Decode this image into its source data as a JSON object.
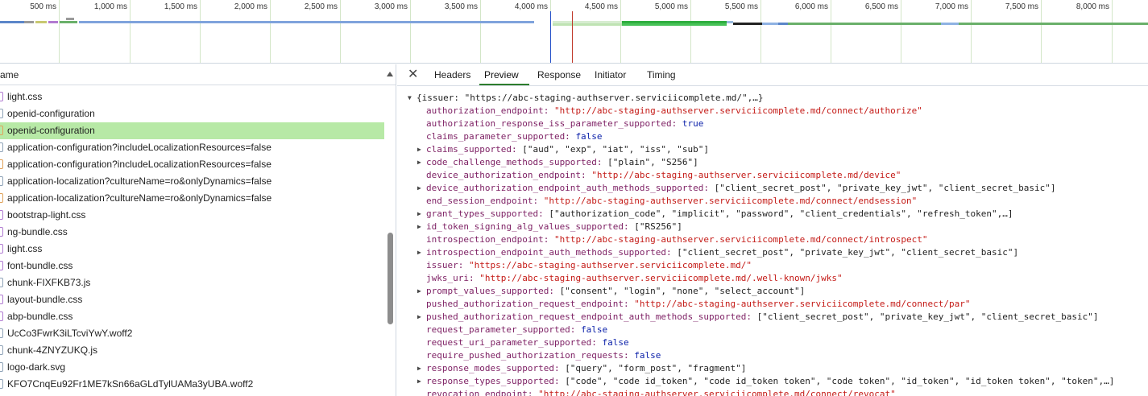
{
  "timeline": {
    "ticks": [
      "500 ms",
      "1,000 ms",
      "1,500 ms",
      "2,000 ms",
      "2,500 ms",
      "3,000 ms",
      "3,500 ms",
      "4,000 ms",
      "4,500 ms",
      "5,000 ms",
      "5,500 ms",
      "6,000 ms",
      "6,500 ms",
      "7,000 ms",
      "7,500 ms",
      "8,000 ms"
    ]
  },
  "name_list": {
    "header": "ame",
    "rows": [
      {
        "label": "light.css",
        "type": "css",
        "selected": false
      },
      {
        "label": "openid-configuration",
        "type": "doc",
        "selected": false
      },
      {
        "label": "openid-configuration",
        "type": "xhr",
        "selected": true
      },
      {
        "label": "application-configuration?includeLocalizationResources=false",
        "type": "doc",
        "selected": false
      },
      {
        "label": "application-configuration?includeLocalizationResources=false",
        "type": "xhr",
        "selected": false
      },
      {
        "label": "application-localization?cultureName=ro&onlyDynamics=false",
        "type": "doc",
        "selected": false
      },
      {
        "label": "application-localization?cultureName=ro&onlyDynamics=false",
        "type": "xhr",
        "selected": false
      },
      {
        "label": "bootstrap-light.css",
        "type": "css",
        "selected": false
      },
      {
        "label": "ng-bundle.css",
        "type": "css",
        "selected": false
      },
      {
        "label": "light.css",
        "type": "css",
        "selected": false
      },
      {
        "label": "font-bundle.css",
        "type": "css",
        "selected": false
      },
      {
        "label": "chunk-FIXFKB73.js",
        "type": "doc",
        "selected": false
      },
      {
        "label": "layout-bundle.css",
        "type": "css",
        "selected": false
      },
      {
        "label": "abp-bundle.css",
        "type": "css",
        "selected": false
      },
      {
        "label": "UcCo3FwrK3iLTcviYwY.woff2",
        "type": "doc",
        "selected": false
      },
      {
        "label": "chunk-4ZNYZUKQ.js",
        "type": "doc",
        "selected": false
      },
      {
        "label": "logo-dark.svg",
        "type": "doc",
        "selected": false
      },
      {
        "label": "KFO7CnqEu92Fr1ME7kSn66aGLdTylUAMa3yUBA.woff2",
        "type": "doc",
        "selected": false
      }
    ]
  },
  "tabs": [
    "Headers",
    "Preview",
    "Response",
    "Initiator",
    "Timing"
  ],
  "active_tab": "Preview",
  "preview": [
    {
      "expand": "open",
      "indent": 0,
      "parts": [
        {
          "c": "plain",
          "t": "{issuer: \"https://abc-staging-authserver.serviciicomplete.md/\",…}"
        }
      ]
    },
    {
      "expand": "",
      "indent": 1,
      "parts": [
        {
          "c": "key",
          "t": "authorization_endpoint: "
        },
        {
          "c": "str",
          "t": "\"http://abc-staging-authserver.serviciicomplete.md/connect/authorize\""
        }
      ]
    },
    {
      "expand": "",
      "indent": 1,
      "parts": [
        {
          "c": "key",
          "t": "authorization_response_iss_parameter_supported: "
        },
        {
          "c": "bool",
          "t": "true"
        }
      ]
    },
    {
      "expand": "",
      "indent": 1,
      "parts": [
        {
          "c": "key",
          "t": "claims_parameter_supported: "
        },
        {
          "c": "bool",
          "t": "false"
        }
      ]
    },
    {
      "expand": "closed",
      "indent": 1,
      "parts": [
        {
          "c": "key",
          "t": "claims_supported: "
        },
        {
          "c": "plain",
          "t": "[\"aud\", \"exp\", \"iat\", \"iss\", \"sub\"]"
        }
      ]
    },
    {
      "expand": "closed",
      "indent": 1,
      "parts": [
        {
          "c": "key",
          "t": "code_challenge_methods_supported: "
        },
        {
          "c": "plain",
          "t": "[\"plain\", \"S256\"]"
        }
      ]
    },
    {
      "expand": "",
      "indent": 1,
      "parts": [
        {
          "c": "key",
          "t": "device_authorization_endpoint: "
        },
        {
          "c": "str",
          "t": "\"http://abc-staging-authserver.serviciicomplete.md/device\""
        }
      ]
    },
    {
      "expand": "closed",
      "indent": 1,
      "parts": [
        {
          "c": "key",
          "t": "device_authorization_endpoint_auth_methods_supported: "
        },
        {
          "c": "plain",
          "t": "[\"client_secret_post\", \"private_key_jwt\", \"client_secret_basic\"]"
        }
      ]
    },
    {
      "expand": "",
      "indent": 1,
      "parts": [
        {
          "c": "key",
          "t": "end_session_endpoint: "
        },
        {
          "c": "str",
          "t": "\"http://abc-staging-authserver.serviciicomplete.md/connect/endsession\""
        }
      ]
    },
    {
      "expand": "closed",
      "indent": 1,
      "parts": [
        {
          "c": "key",
          "t": "grant_types_supported: "
        },
        {
          "c": "plain",
          "t": "[\"authorization_code\", \"implicit\", \"password\", \"client_credentials\", \"refresh_token\",…]"
        }
      ]
    },
    {
      "expand": "closed",
      "indent": 1,
      "parts": [
        {
          "c": "key",
          "t": "id_token_signing_alg_values_supported: "
        },
        {
          "c": "plain",
          "t": "[\"RS256\"]"
        }
      ]
    },
    {
      "expand": "",
      "indent": 1,
      "parts": [
        {
          "c": "key",
          "t": "introspection_endpoint: "
        },
        {
          "c": "str",
          "t": "\"http://abc-staging-authserver.serviciicomplete.md/connect/introspect\""
        }
      ]
    },
    {
      "expand": "closed",
      "indent": 1,
      "parts": [
        {
          "c": "key",
          "t": "introspection_endpoint_auth_methods_supported: "
        },
        {
          "c": "plain",
          "t": "[\"client_secret_post\", \"private_key_jwt\", \"client_secret_basic\"]"
        }
      ]
    },
    {
      "expand": "",
      "indent": 1,
      "parts": [
        {
          "c": "key",
          "t": "issuer: "
        },
        {
          "c": "str",
          "t": "\"https://abc-staging-authserver.serviciicomplete.md/\""
        }
      ]
    },
    {
      "expand": "",
      "indent": 1,
      "parts": [
        {
          "c": "key",
          "t": "jwks_uri: "
        },
        {
          "c": "str",
          "t": "\"http://abc-staging-authserver.serviciicomplete.md/.well-known/jwks\""
        }
      ]
    },
    {
      "expand": "closed",
      "indent": 1,
      "parts": [
        {
          "c": "key",
          "t": "prompt_values_supported: "
        },
        {
          "c": "plain",
          "t": "[\"consent\", \"login\", \"none\", \"select_account\"]"
        }
      ]
    },
    {
      "expand": "",
      "indent": 1,
      "parts": [
        {
          "c": "key",
          "t": "pushed_authorization_request_endpoint: "
        },
        {
          "c": "str",
          "t": "\"http://abc-staging-authserver.serviciicomplete.md/connect/par\""
        }
      ]
    },
    {
      "expand": "closed",
      "indent": 1,
      "parts": [
        {
          "c": "key",
          "t": "pushed_authorization_request_endpoint_auth_methods_supported: "
        },
        {
          "c": "plain",
          "t": "[\"client_secret_post\", \"private_key_jwt\", \"client_secret_basic\"]"
        }
      ]
    },
    {
      "expand": "",
      "indent": 1,
      "parts": [
        {
          "c": "key",
          "t": "request_parameter_supported: "
        },
        {
          "c": "bool",
          "t": "false"
        }
      ]
    },
    {
      "expand": "",
      "indent": 1,
      "parts": [
        {
          "c": "key",
          "t": "request_uri_parameter_supported: "
        },
        {
          "c": "bool",
          "t": "false"
        }
      ]
    },
    {
      "expand": "",
      "indent": 1,
      "parts": [
        {
          "c": "key",
          "t": "require_pushed_authorization_requests: "
        },
        {
          "c": "bool",
          "t": "false"
        }
      ]
    },
    {
      "expand": "closed",
      "indent": 1,
      "parts": [
        {
          "c": "key",
          "t": "response_modes_supported: "
        },
        {
          "c": "plain",
          "t": "[\"query\", \"form_post\", \"fragment\"]"
        }
      ]
    },
    {
      "expand": "closed",
      "indent": 1,
      "parts": [
        {
          "c": "key",
          "t": "response_types_supported: "
        },
        {
          "c": "plain",
          "t": "[\"code\", \"code id_token\", \"code id_token token\", \"code token\", \"id_token\", \"id_token token\", \"token\",…]"
        }
      ]
    },
    {
      "expand": "",
      "indent": 1,
      "parts": [
        {
          "c": "key",
          "t": "revocation_endpoint: "
        },
        {
          "c": "str",
          "t": "\"http://abc-staging-authserver.serviciicomplete.md/connect/revocat\""
        }
      ]
    }
  ]
}
